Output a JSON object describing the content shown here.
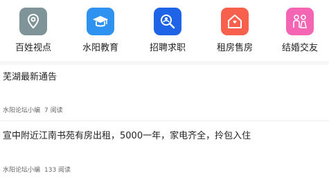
{
  "categories": [
    {
      "label": "百姓视点",
      "icon": "location-pin-icon",
      "color": "#7f9498"
    },
    {
      "label": "水阳教育",
      "icon": "graduation-cap-icon",
      "color": "#2e92f0"
    },
    {
      "label": "招聘求职",
      "icon": "search-person-icon",
      "color": "#1f64e6"
    },
    {
      "label": "租房售房",
      "icon": "house-icon",
      "color": "#f6604d"
    },
    {
      "label": "结婚交友",
      "icon": "couple-icon",
      "color": "#f466b4"
    }
  ],
  "posts": [
    {
      "title": "芜湖最新通告",
      "author": "水阳论坛小编",
      "views": "7 阅读"
    },
    {
      "title": "宣中附近江南书苑有房出租，5000一年，家电齐全，拎包入住",
      "author": "水阳论坛小编",
      "views": "133 阅读"
    }
  ]
}
